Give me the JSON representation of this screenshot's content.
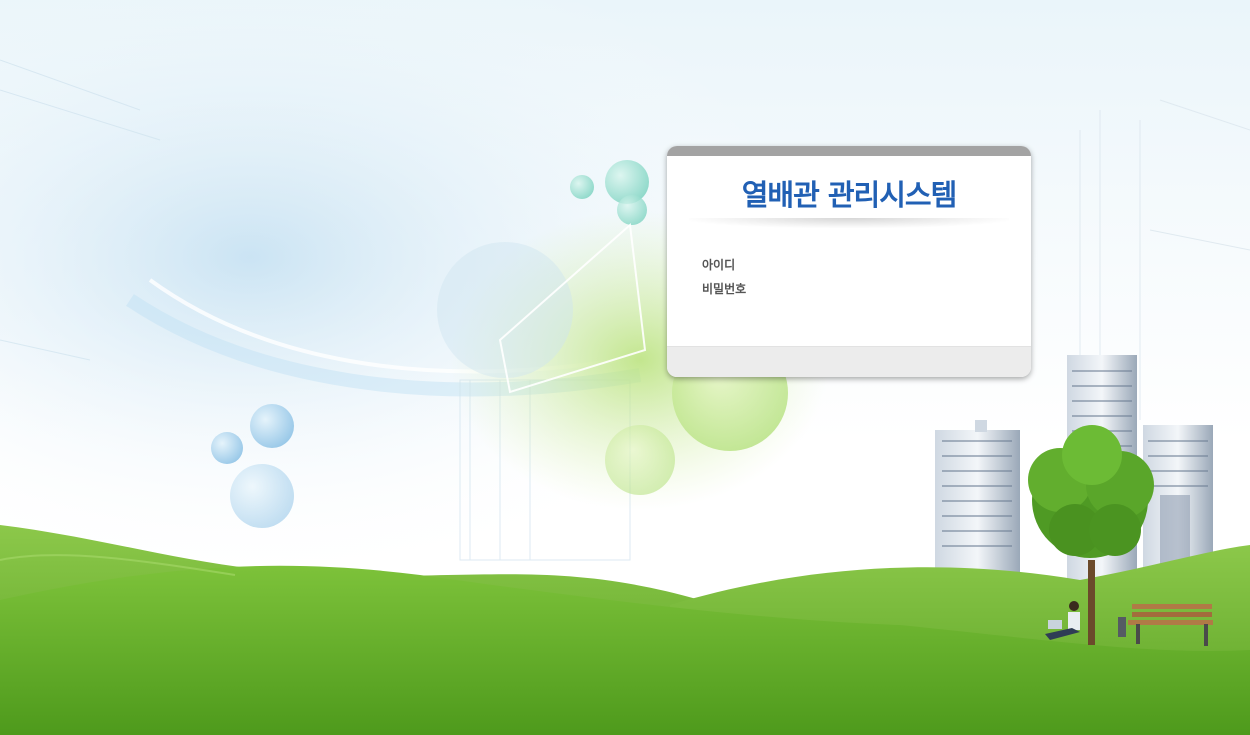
{
  "login": {
    "title": "열배관 관리시스템",
    "id_label": "아이디",
    "password_label": "비밀번호",
    "id_value": "",
    "password_value": ""
  },
  "colors": {
    "title": "#2160b4",
    "card_topbar": "#a3a3a3",
    "card_footer": "#ececec",
    "grass": "#6bb52a",
    "sky": "#eaf5fa"
  }
}
